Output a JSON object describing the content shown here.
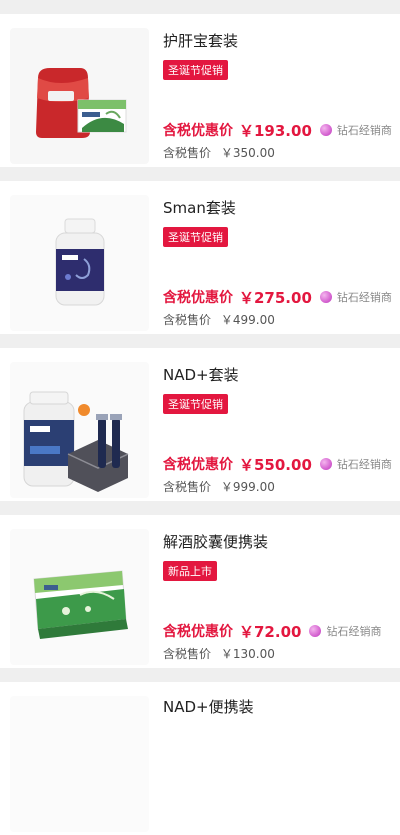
{
  "products": [
    {
      "title": "护肝宝套装",
      "tag": "圣诞节促销",
      "discount_label": "含税优惠价",
      "discount_price": "￥193.00",
      "member_level": "钻石经销商",
      "original_label": "含税售价",
      "original_price": "￥350.00",
      "image_icon": "liver-care-set-image"
    },
    {
      "title": "Sman套装",
      "tag": "圣诞节促销",
      "discount_label": "含税优惠价",
      "discount_price": "￥275.00",
      "member_level": "钻石经销商",
      "original_label": "含税售价",
      "original_price": "￥499.00",
      "image_icon": "supplement-bottle-image"
    },
    {
      "title": "NAD+套装",
      "tag": "圣诞节促销",
      "discount_label": "含税优惠价",
      "discount_price": "￥550.00",
      "member_level": "钻石经销商",
      "original_label": "含税售价",
      "original_price": "￥999.00",
      "image_icon": "nad-set-image"
    },
    {
      "title": "解酒胶囊便携装",
      "tag": "新品上市",
      "discount_label": "含税优惠价",
      "discount_price": "￥72.00",
      "member_level": "钻石经销商",
      "original_label": "含税售价",
      "original_price": "￥130.00",
      "image_icon": "hangover-capsule-box-image"
    },
    {
      "title": "NAD+便携装"
    }
  ],
  "colors": {
    "accent": "#e3173f",
    "background": "#efefef",
    "card": "#ffffff"
  }
}
